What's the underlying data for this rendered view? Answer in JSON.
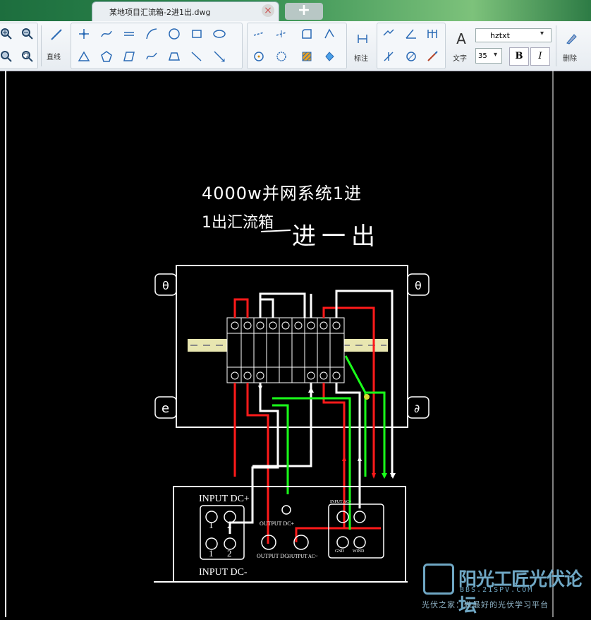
{
  "tab": {
    "title": "某地项目汇流箱-2进1出.dwg",
    "close": "×",
    "new": "+"
  },
  "toolbar": {
    "line_label": "直线",
    "dim_label": "标注",
    "text_label": "文字",
    "delete_label": "删除",
    "font_name": "hztxt",
    "font_size": "35",
    "bold": "B",
    "italic": "I",
    "text_icon": "A"
  },
  "drawing": {
    "title_line1": "4000w并网系统1进",
    "title_line2": "1出汇流箱",
    "handwritten": "进一出",
    "input_dc_plus": "INPUT DC+",
    "input_dc_minus": "INPUT DC-",
    "output_dc_plus": "OUTPUT DC+",
    "output_dc_minus": "OUTPUT DC-",
    "output_ac": "OUTPUT AC~",
    "input_ac": "INPUT AC~",
    "gnd": "GND",
    "wind": "WIND",
    "n1": "1",
    "n2": "2",
    "n1b": "1",
    "n2b": "2",
    "mount_a": "θ",
    "mount_b": "θ",
    "mount_c": "e",
    "mount_d": "∂"
  },
  "watermark": {
    "title": "阳光工匠光伏论坛",
    "url": "BBS.21SPV.COM",
    "sub": "光伏之家：做最好的光伏学习平台"
  },
  "colors": {
    "red": "#ff1a1a",
    "green": "#1aff1a",
    "white": "#ffffff",
    "rail": "#e8e6b0"
  }
}
